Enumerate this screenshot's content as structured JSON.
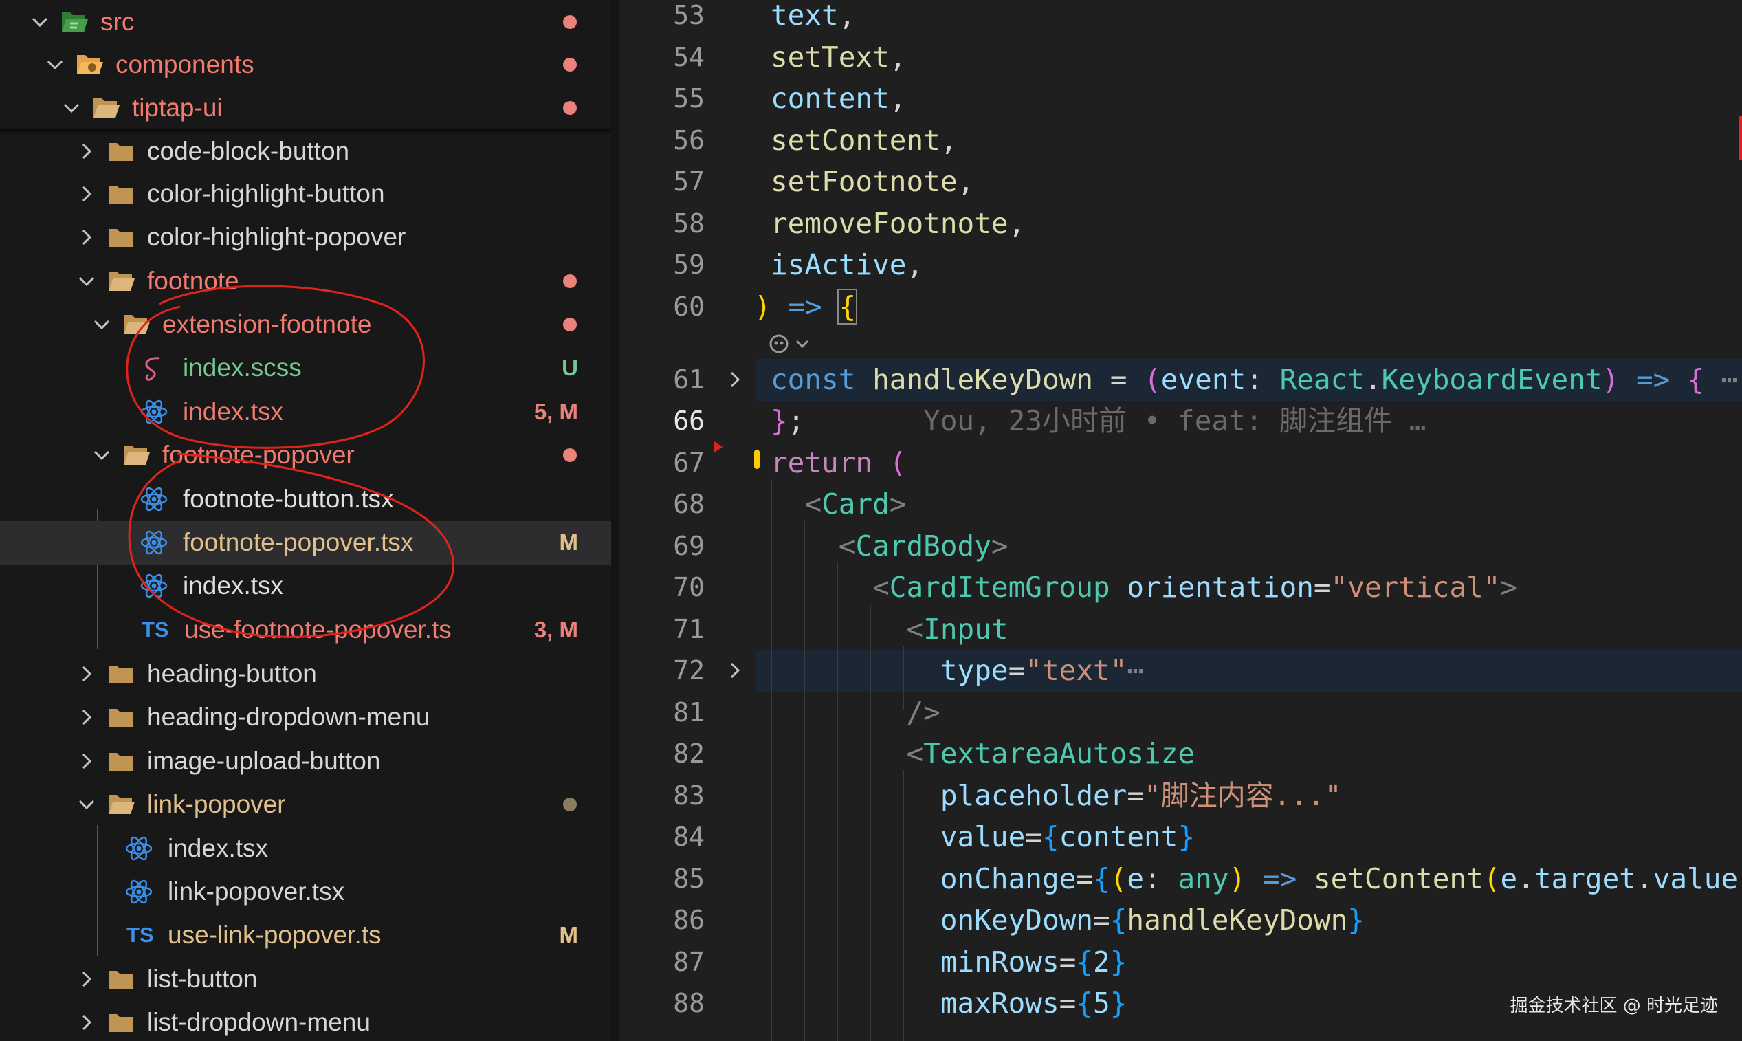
{
  "explorer": {
    "items": [
      {
        "label": "src",
        "color": "#f07b6e",
        "badge": "",
        "dot": "#e9827a"
      },
      {
        "label": "components",
        "color": "#f07b6e",
        "badge": "",
        "dot": "#e9827a"
      },
      {
        "label": "tiptap-ui",
        "color": "#f07b6e",
        "badge": "",
        "dot": "#e9827a"
      },
      {
        "label": "code-block-button",
        "color": "#d7d7d7",
        "badge": "",
        "dot": ""
      },
      {
        "label": "color-highlight-button",
        "color": "#d7d7d7",
        "badge": "",
        "dot": ""
      },
      {
        "label": "color-highlight-popover",
        "color": "#d7d7d7",
        "badge": "",
        "dot": ""
      },
      {
        "label": "footnote",
        "color": "#f07b6e",
        "badge": "",
        "dot": "#e9827a"
      },
      {
        "label": "extension-footnote",
        "color": "#f07b6e",
        "badge": "",
        "dot": "#e9827a"
      },
      {
        "label": "index.scss",
        "color": "#73c991",
        "badge": "U",
        "badge_color": "#73c991",
        "dot": ""
      },
      {
        "label": "index.tsx",
        "color": "#f07b6e",
        "badge": "5, M",
        "badge_color": "#e9827a",
        "dot": ""
      },
      {
        "label": "footnote-popover",
        "color": "#f07b6e",
        "badge": "",
        "dot": "#e9827a"
      },
      {
        "label": "footnote-button.tsx",
        "color": "#e0e0e0",
        "badge": "",
        "dot": ""
      },
      {
        "label": "footnote-popover.tsx",
        "color": "#e2c08d",
        "badge": "M",
        "badge_color": "#e2c08d",
        "dot": ""
      },
      {
        "label": "index.tsx",
        "color": "#e0e0e0",
        "badge": "",
        "dot": ""
      },
      {
        "label": "use-footnote-popover.ts",
        "color": "#f07b6e",
        "badge": "3, M",
        "badge_color": "#e9827a",
        "dot": ""
      },
      {
        "label": "heading-button",
        "color": "#d7d7d7",
        "badge": "",
        "dot": ""
      },
      {
        "label": "heading-dropdown-menu",
        "color": "#d7d7d7",
        "badge": "",
        "dot": ""
      },
      {
        "label": "image-upload-button",
        "color": "#d7d7d7",
        "badge": "",
        "dot": ""
      },
      {
        "label": "link-popover",
        "color": "#e2c08d",
        "badge": "",
        "dot": "#8a7c5c"
      },
      {
        "label": "index.tsx",
        "color": "#d7d7d7",
        "badge": "",
        "dot": ""
      },
      {
        "label": "link-popover.tsx",
        "color": "#d7d7d7",
        "badge": "",
        "dot": ""
      },
      {
        "label": "use-link-popover.ts",
        "color": "#e2c08d",
        "badge": "M",
        "badge_color": "#e2c08d",
        "dot": ""
      },
      {
        "label": "list-button",
        "color": "#d7d7d7",
        "badge": "",
        "dot": ""
      },
      {
        "label": "list-dropdown-menu",
        "color": "#d7d7d7",
        "badge": "",
        "dot": ""
      }
    ],
    "ts_label": "TS"
  },
  "editor": {
    "line_numbers": [
      "53",
      "54",
      "55",
      "56",
      "57",
      "58",
      "59",
      "60",
      "61",
      "66",
      "67",
      "68",
      "69",
      "70",
      "71",
      "72",
      "81",
      "82",
      "83",
      "84",
      "85",
      "86",
      "87",
      "88"
    ],
    "blame": "You, 23小时前 • feat: 脚注组件 …",
    "ellipsis": "⋯",
    "tokens": {
      "text": "text",
      "setText": "setText",
      "content": "content",
      "setContent": "setContent",
      "setFootnote": "setFootnote",
      "removeFootnote": "removeFootnote",
      "isActive": "isActive",
      "const": "const",
      "handleKeyDown": "handleKeyDown",
      "event": "event",
      "React": "React",
      "KeyboardEvent": "KeyboardEvent",
      "return": "return",
      "Card": "Card",
      "CardBody": "CardBody",
      "CardItemGroup": "CardItemGroup",
      "orientation": "orientation",
      "vertical": "\"vertical\"",
      "Input": "Input",
      "type": "type",
      "textStr": "\"text\"",
      "TextareaAutosize": "TextareaAutosize",
      "placeholder": "placeholder",
      "placeholderStr": "\"脚注内容...\"",
      "value": "value",
      "onChange": "onChange",
      "e": "e",
      "any": "any",
      "target": "target",
      "onKeyDown": "onKeyDown",
      "minRows": "minRows",
      "maxRows": "maxRows",
      "two": "2",
      "five": "5"
    }
  },
  "watermark": "掘金技术社区 @ 时光足迹"
}
